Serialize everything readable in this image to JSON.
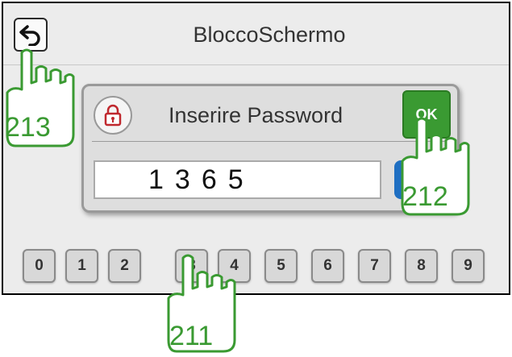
{
  "header": {
    "title": "BloccoSchermo",
    "back_icon": "back-arrow-icon"
  },
  "dialog": {
    "lock_icon": "padlock-icon",
    "prompt": "Inserire Password",
    "ok_label": "OK",
    "password_value": "1365"
  },
  "keypad": [
    "0",
    "1",
    "2",
    "3",
    "4",
    "5",
    "6",
    "7",
    "8",
    "9"
  ],
  "callouts": {
    "keypad": "211",
    "ok": "212",
    "back": "213"
  },
  "colors": {
    "ok_green": "#3a9a32",
    "callout_green": "#3a9a32",
    "blue_button": "#1f6fc2"
  }
}
